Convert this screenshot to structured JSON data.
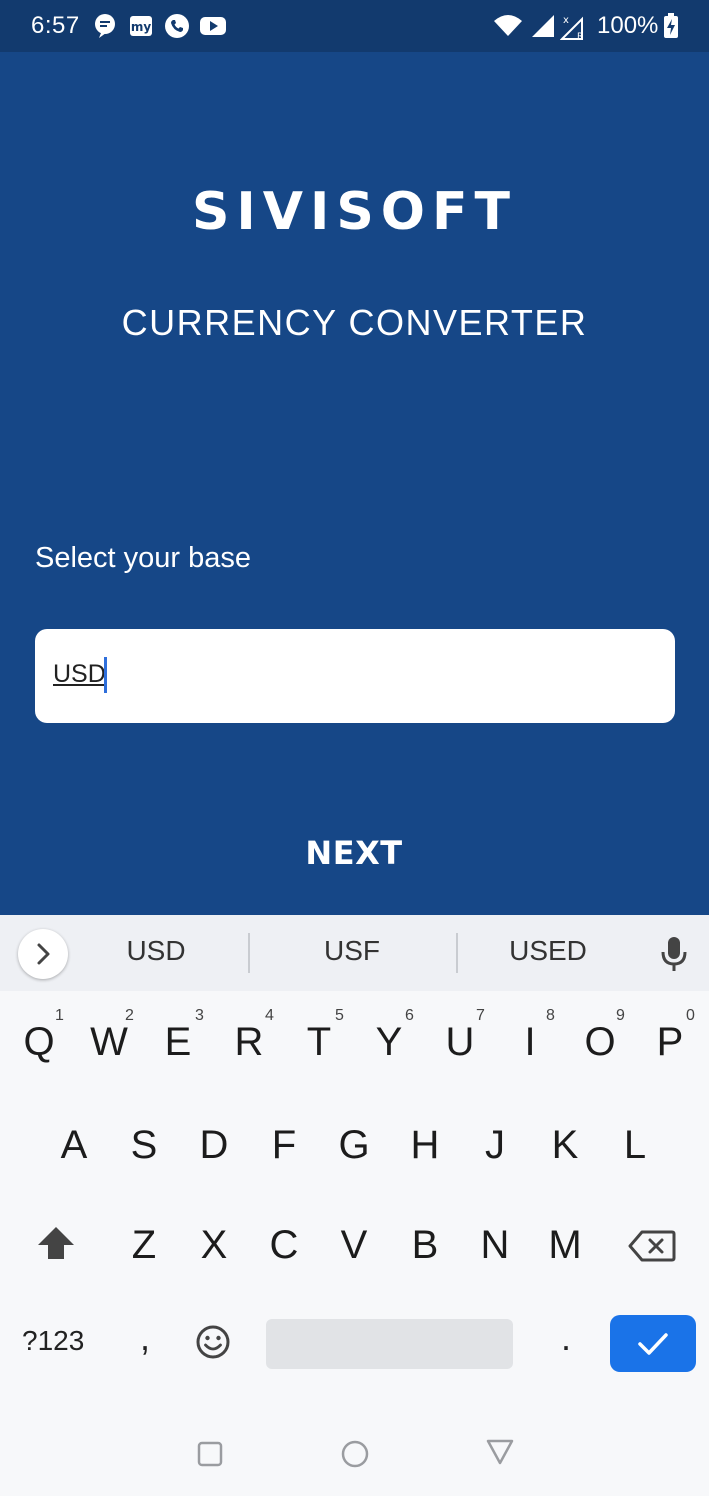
{
  "status_bar": {
    "time": "6:57",
    "battery": "100%",
    "icons": [
      "chat-icon",
      "paytm-icon",
      "phone-icon",
      "youtube-icon",
      "wifi-icon",
      "signal-icon",
      "no-signal-icon",
      "battery-charging-icon"
    ]
  },
  "app": {
    "brand": "SIVISOFT",
    "subtitle": "CURRENCY CONVERTER",
    "base_label": "Select your base",
    "base_input_value": "USD",
    "next_label": "NEXT",
    "colors": {
      "background": "#164787",
      "status_bar": "#123a6e",
      "text": "#ffffff"
    }
  },
  "keyboard": {
    "suggestions": [
      "USD",
      "USF",
      "USED"
    ],
    "row1": [
      "Q",
      "W",
      "E",
      "R",
      "T",
      "Y",
      "U",
      "I",
      "O",
      "P"
    ],
    "row1_nums": [
      "1",
      "2",
      "3",
      "4",
      "5",
      "6",
      "7",
      "8",
      "9",
      "0"
    ],
    "row2": [
      "A",
      "S",
      "D",
      "F",
      "G",
      "H",
      "J",
      "K",
      "L"
    ],
    "row3": [
      "Z",
      "X",
      "C",
      "V",
      "B",
      "N",
      "M"
    ],
    "symbols_key": "?123",
    "comma": ",",
    "period": ".",
    "enter_color": "#1a73e8"
  }
}
